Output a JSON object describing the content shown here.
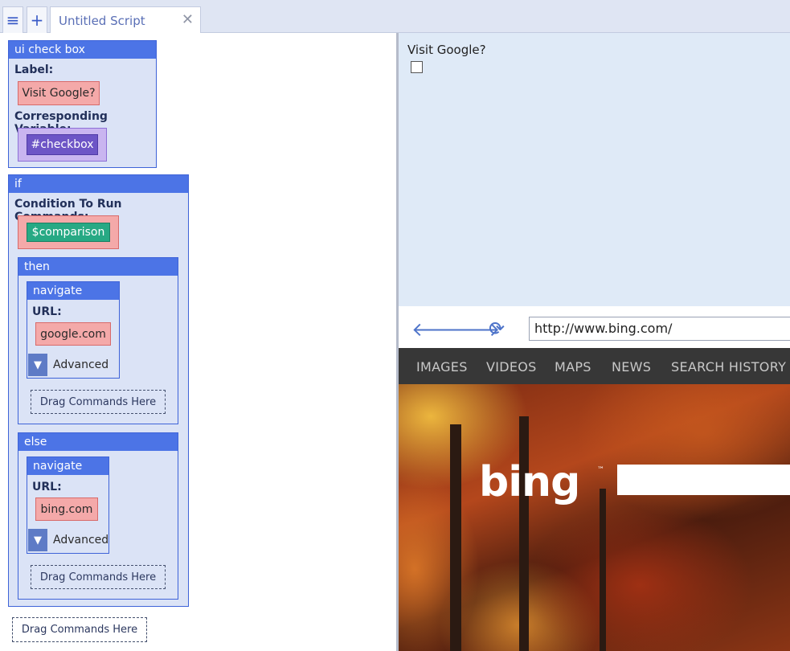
{
  "tabs": {
    "menu_icon": "hamburger-icon",
    "new_icon": "plus-icon",
    "title": "Untitled Script",
    "close_glyph": "✕"
  },
  "script": {
    "ui_check_box": {
      "header": "ui check box",
      "label_caption": "Label:",
      "label_value": "Visit Google?",
      "variable_caption": "Corresponding Variable:",
      "variable_value": "#checkbox"
    },
    "if_block": {
      "header": "if",
      "condition_caption": "Condition To Run Commands:",
      "condition_value": "$comparison",
      "then": {
        "header": "then",
        "navigate": {
          "header": "navigate",
          "url_caption": "URL:",
          "url_value": "google.com",
          "advanced_label": "Advanced"
        },
        "drop_hint": "Drag Commands Here"
      },
      "else": {
        "header": "else",
        "navigate": {
          "header": "navigate",
          "url_caption": "URL:",
          "url_value": "bing.com",
          "advanced_label": "Advanced"
        },
        "drop_hint": "Drag Commands Here"
      }
    },
    "root_drop_hint": "Drag Commands Here"
  },
  "preview": {
    "checkbox_label": "Visit Google?",
    "checkbox_checked": false
  },
  "browser": {
    "url": "http://www.bing.com/",
    "nav_links": [
      "IMAGES",
      "VIDEOS",
      "MAPS",
      "NEWS",
      "SEARCH HISTORY"
    ],
    "logo_text": "bing",
    "logo_tm": "™"
  }
}
